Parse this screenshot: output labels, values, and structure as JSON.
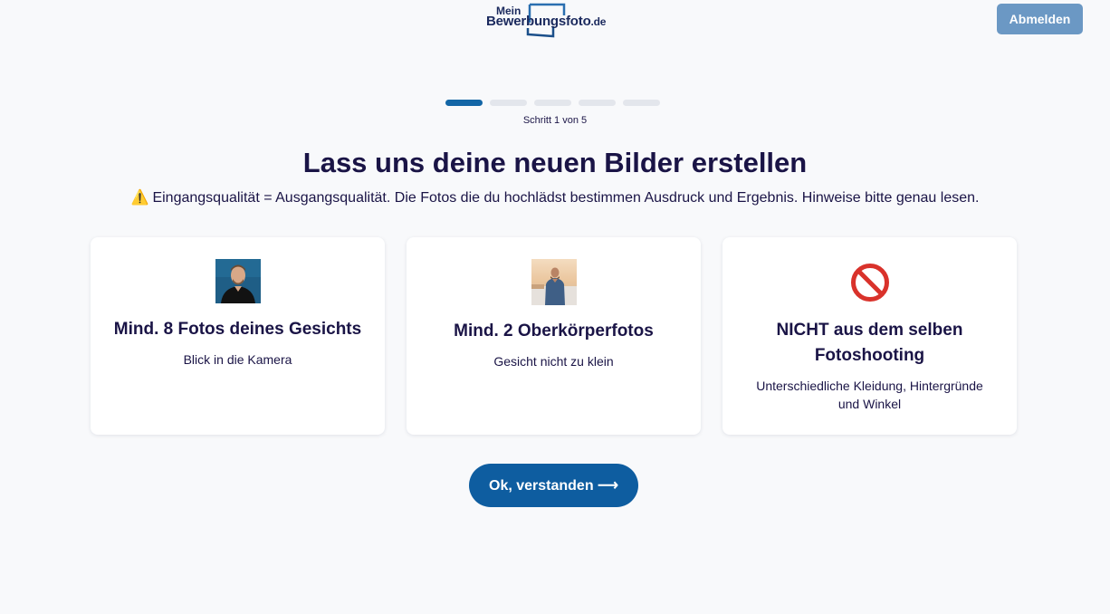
{
  "header": {
    "logo_prefix": "Mein",
    "logo_main": "Bewerbungsfoto",
    "logo_tld": ".de",
    "logout_label": "Abmelden"
  },
  "progress": {
    "current_step": 1,
    "total_steps": 5,
    "label": "Schritt 1 von 5"
  },
  "main": {
    "headline": "Lass uns deine neuen Bilder erstellen",
    "warning_icon": "⚠️",
    "warning_text": "Eingangsqualität = Ausgangsqualität. Die Fotos die du hochlädst bestimmen Ausdruck und Ergebnis. Hinweise bitte genau lesen."
  },
  "cards": [
    {
      "icon": "face-photo",
      "title": "Mind. 8 Fotos deines Gesichts",
      "subtitle": "Blick in die Kamera"
    },
    {
      "icon": "upper-body-photo",
      "title": "Mind. 2 Oberkörperfotos",
      "subtitle": "Gesicht nicht zu klein"
    },
    {
      "icon": "prohibited-icon",
      "title": "NICHT aus dem selben Fotoshooting",
      "subtitle": "Unterschiedliche Kleidung, Hintergründe und Winkel"
    }
  ],
  "cta": {
    "label": "Ok, verstanden ⟶"
  },
  "colors": {
    "accent": "#0e5da0",
    "progress_active": "#1366a6",
    "logout_bg": "#6b98c4",
    "text": "#1a1446",
    "prohibited": "#d9322b"
  }
}
